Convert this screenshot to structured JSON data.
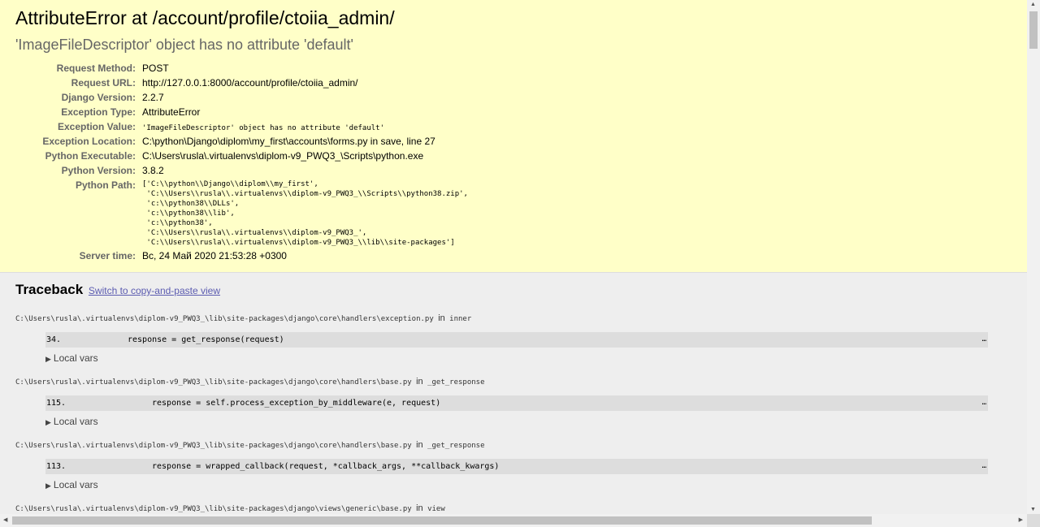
{
  "summary": {
    "title": "AttributeError at /account/profile/ctoiia_admin/",
    "subtitle": "'ImageFileDescriptor' object has no attribute 'default'",
    "meta": {
      "request_method_label": "Request Method:",
      "request_method": "POST",
      "request_url_label": "Request URL:",
      "request_url": "http://127.0.0.1:8000/account/profile/ctoiia_admin/",
      "django_version_label": "Django Version:",
      "django_version": "2.2.7",
      "exception_type_label": "Exception Type:",
      "exception_type": "AttributeError",
      "exception_value_label": "Exception Value:",
      "exception_value": "'ImageFileDescriptor' object has no attribute 'default'",
      "exception_location_label": "Exception Location:",
      "exception_location": "C:\\python\\Django\\diplom\\my_first\\accounts\\forms.py in save, line 27",
      "python_executable_label": "Python Executable:",
      "python_executable": "C:\\Users\\rusla\\.virtualenvs\\diplom-v9_PWQ3_\\Scripts\\python.exe",
      "python_version_label": "Python Version:",
      "python_version": "3.8.2",
      "python_path_label": "Python Path:",
      "python_path": "['C:\\\\python\\\\Django\\\\diplom\\\\my_first',\n 'C:\\\\Users\\\\rusla\\\\.virtualenvs\\\\diplom-v9_PWQ3_\\\\Scripts\\\\python38.zip',\n 'c:\\\\python38\\\\DLLs',\n 'c:\\\\python38\\\\lib',\n 'c:\\\\python38',\n 'C:\\\\Users\\\\rusla\\\\.virtualenvs\\\\diplom-v9_PWQ3_',\n 'C:\\\\Users\\\\rusla\\\\.virtualenvs\\\\diplom-v9_PWQ3_\\\\lib\\\\site-packages']",
      "server_time_label": "Server time:",
      "server_time": "Вс, 24 Май 2020 21:53:28 +0300"
    }
  },
  "traceback": {
    "heading": "Traceback",
    "switch_link": "Switch to copy-and-paste view",
    "in_word": "in",
    "local_vars_label": "Local vars",
    "ellipsis": "…",
    "frames": [
      {
        "file": "C:\\Users\\rusla\\.virtualenvs\\diplom-v9_PWQ3_\\lib\\site-packages\\django\\core\\handlers\\exception.py",
        "func": "inner",
        "lineno": "34.",
        "code": "response = get_response(request)"
      },
      {
        "file": "C:\\Users\\rusla\\.virtualenvs\\diplom-v9_PWQ3_\\lib\\site-packages\\django\\core\\handlers\\base.py",
        "func": "_get_response",
        "lineno": "115.",
        "code": "response = self.process_exception_by_middleware(e, request)"
      },
      {
        "file": "C:\\Users\\rusla\\.virtualenvs\\diplom-v9_PWQ3_\\lib\\site-packages\\django\\core\\handlers\\base.py",
        "func": "_get_response",
        "lineno": "113.",
        "code": "response = wrapped_callback(request, *callback_args, **callback_kwargs)"
      },
      {
        "file": "C:\\Users\\rusla\\.virtualenvs\\diplom-v9_PWQ3_\\lib\\site-packages\\django\\views\\generic\\base.py",
        "func": "view"
      }
    ]
  },
  "scrollbars": {
    "up_arrow": "▲",
    "down_arrow": "▼",
    "left_arrow": "◀",
    "right_arrow": "▶"
  },
  "icons": {
    "expand": "▶"
  }
}
